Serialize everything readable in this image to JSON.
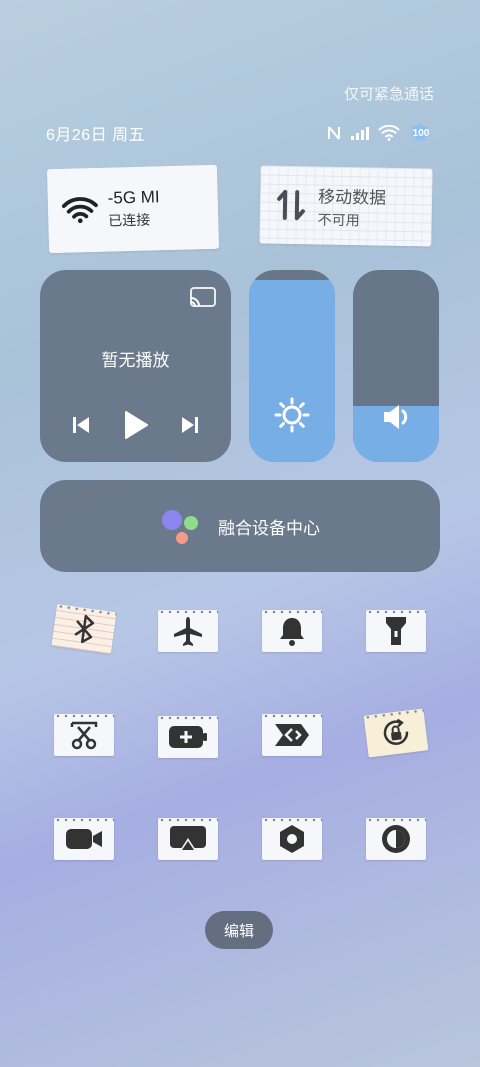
{
  "status": {
    "emergency_text": "仅可紧急通话",
    "date": "6月26日 周五",
    "battery": "100"
  },
  "tiles": {
    "wifi": {
      "title": "-5G   MI",
      "subtitle": "已连接",
      "icon": "wifi-icon"
    },
    "mobile_data": {
      "title": "移动数据",
      "subtitle": "不可用",
      "icon": "data-arrows-icon"
    }
  },
  "media": {
    "title": "暂无播放"
  },
  "sliders": {
    "brightness_level": 0.95,
    "volume_level": 0.29
  },
  "hub": {
    "label": "融合设备中心"
  },
  "toggles": [
    {
      "name": "bluetooth",
      "icon": "bluetooth-icon"
    },
    {
      "name": "airplane-mode",
      "icon": "airplane-icon"
    },
    {
      "name": "sound",
      "icon": "bell-icon"
    },
    {
      "name": "flashlight",
      "icon": "flashlight-icon"
    },
    {
      "name": "screenshot",
      "icon": "scissors-icon"
    },
    {
      "name": "battery-saver",
      "icon": "battery-plus-icon"
    },
    {
      "name": "nearby-share",
      "icon": "share-icon"
    },
    {
      "name": "auto-rotate",
      "icon": "rotation-lock-icon"
    },
    {
      "name": "screen-record",
      "icon": "video-camera-icon"
    },
    {
      "name": "screen-cast",
      "icon": "cast-icon"
    },
    {
      "name": "settings",
      "icon": "hex-nut-icon"
    },
    {
      "name": "dark-mode",
      "icon": "contrast-icon"
    }
  ],
  "edit_label": "编辑"
}
